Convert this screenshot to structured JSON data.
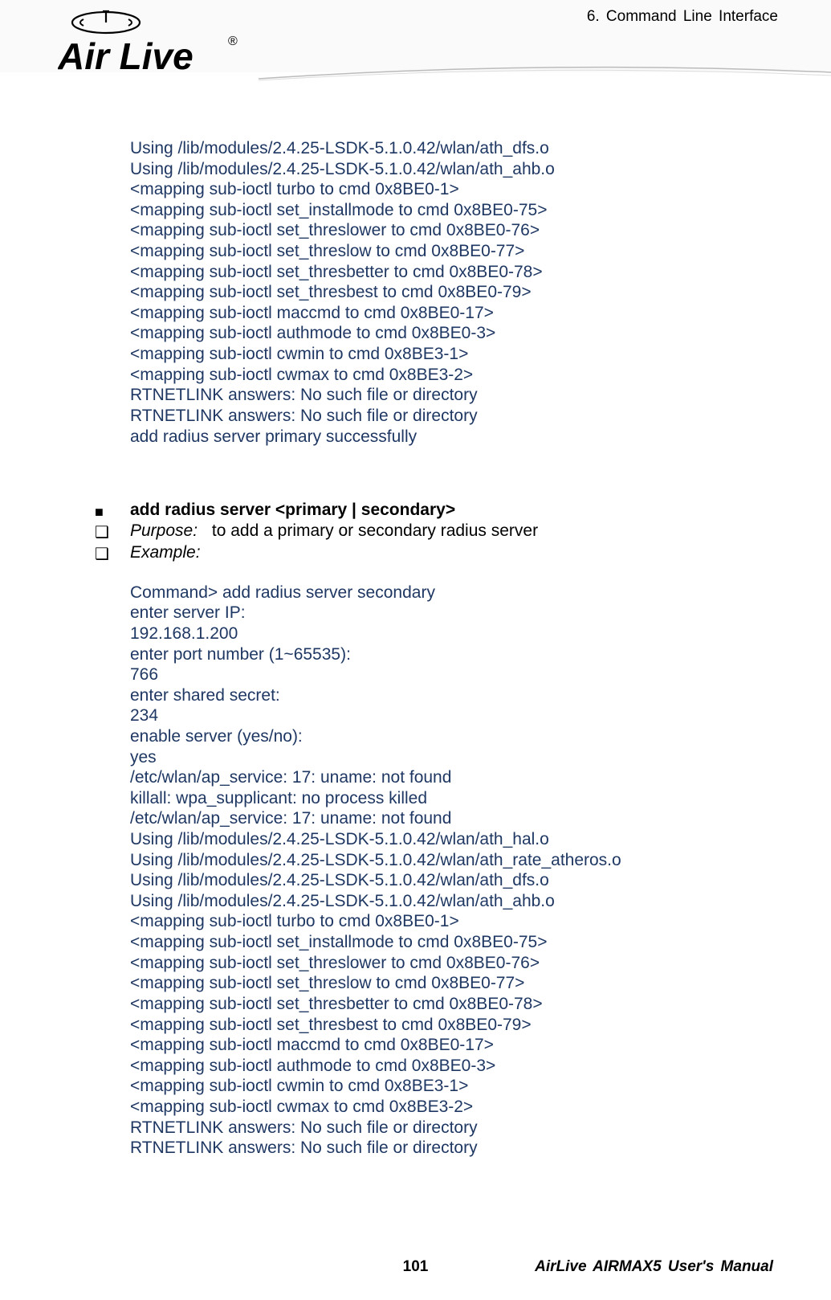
{
  "header": {
    "chapter": "6.    Command  Line  Interface",
    "brand_top": "Air Live"
  },
  "block1": [
    "Using /lib/modules/2.4.25-LSDK-5.1.0.42/wlan/ath_dfs.o",
    "Using /lib/modules/2.4.25-LSDK-5.1.0.42/wlan/ath_ahb.o",
    "<mapping sub-ioctl turbo to cmd 0x8BE0-1>",
    "<mapping sub-ioctl set_installmode to cmd 0x8BE0-75>",
    "<mapping sub-ioctl set_threslower to cmd 0x8BE0-76>",
    "<mapping sub-ioctl set_threslow to cmd 0x8BE0-77>",
    "<mapping sub-ioctl set_thresbetter to cmd 0x8BE0-78>",
    "<mapping sub-ioctl set_thresbest to cmd 0x8BE0-79>",
    "<mapping sub-ioctl maccmd to cmd 0x8BE0-17>",
    "<mapping sub-ioctl authmode to cmd 0x8BE0-3>",
    "<mapping sub-ioctl cwmin to cmd 0x8BE3-1>",
    "<mapping sub-ioctl cwmax to cmd 0x8BE3-2>",
    "RTNETLINK answers: No such file or directory",
    "RTNETLINK answers: No such file or directory",
    "add radius server primary successfully"
  ],
  "cmd": {
    "title": "add radius server <primary | secondary>",
    "purpose_label": "Purpose:",
    "purpose_text": "to add a primary or secondary radius server",
    "example_label": "Example:"
  },
  "block2": [
    "Command> add radius server secondary",
    "enter server IP:",
    "192.168.1.200",
    "enter port number (1~65535):",
    "766",
    "enter shared secret:",
    "234",
    "enable server (yes/no):",
    "yes",
    "/etc/wlan/ap_service: 17: uname: not found",
    "killall: wpa_supplicant: no process killed",
    "/etc/wlan/ap_service: 17: uname: not found",
    "Using /lib/modules/2.4.25-LSDK-5.1.0.42/wlan/ath_hal.o",
    "Using /lib/modules/2.4.25-LSDK-5.1.0.42/wlan/ath_rate_atheros.o",
    "Using /lib/modules/2.4.25-LSDK-5.1.0.42/wlan/ath_dfs.o",
    "Using /lib/modules/2.4.25-LSDK-5.1.0.42/wlan/ath_ahb.o",
    "<mapping sub-ioctl turbo to cmd 0x8BE0-1>",
    "<mapping sub-ioctl set_installmode to cmd 0x8BE0-75>",
    "<mapping sub-ioctl set_threslower to cmd 0x8BE0-76>",
    "<mapping sub-ioctl set_threslow to cmd 0x8BE0-77>",
    "<mapping sub-ioctl set_thresbetter to cmd 0x8BE0-78>",
    "<mapping sub-ioctl set_thresbest to cmd 0x8BE0-79>",
    "<mapping sub-ioctl maccmd to cmd 0x8BE0-17>",
    "<mapping sub-ioctl authmode to cmd 0x8BE0-3>",
    "<mapping sub-ioctl cwmin to cmd 0x8BE3-1>",
    "<mapping sub-ioctl cwmax to cmd 0x8BE3-2>",
    "RTNETLINK answers: No such file or directory",
    "RTNETLINK answers: No such file or directory"
  ],
  "footer": {
    "page": "101",
    "manual": "AirLive  AIRMAX5  User's  Manual"
  }
}
